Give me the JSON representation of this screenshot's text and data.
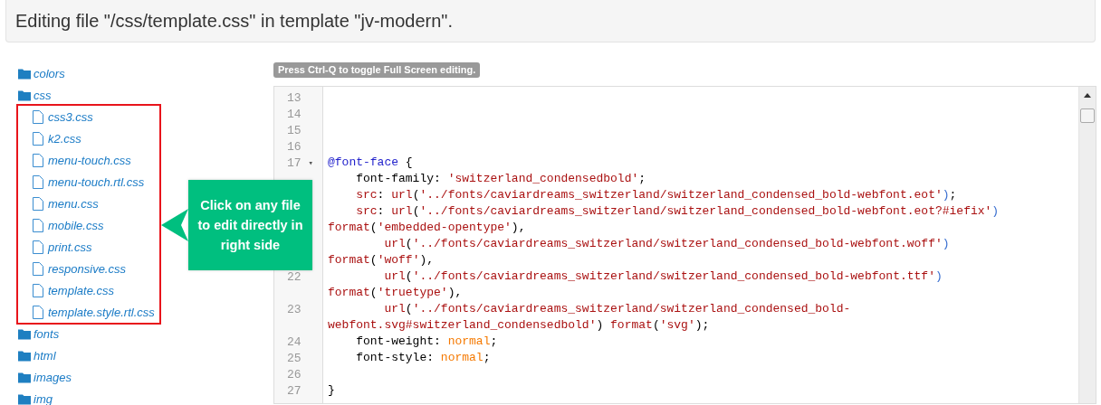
{
  "header": {
    "title": "Editing file \"/css/template.css\" in template \"jv-modern\"."
  },
  "tree": [
    {
      "kind": "folder",
      "name": "colors"
    },
    {
      "kind": "folder",
      "name": "css",
      "highlighted_children": true,
      "children": [
        {
          "kind": "file",
          "name": "css3.css"
        },
        {
          "kind": "file",
          "name": "k2.css"
        },
        {
          "kind": "file",
          "name": "menu-touch.css"
        },
        {
          "kind": "file",
          "name": "menu-touch.rtl.css"
        },
        {
          "kind": "file",
          "name": "menu.css"
        },
        {
          "kind": "file",
          "name": "mobile.css"
        },
        {
          "kind": "file",
          "name": "print.css"
        },
        {
          "kind": "file",
          "name": "responsive.css"
        },
        {
          "kind": "file",
          "name": "template.css"
        },
        {
          "kind": "file",
          "name": "template.style.rtl.css"
        }
      ]
    },
    {
      "kind": "folder",
      "name": "fonts"
    },
    {
      "kind": "folder",
      "name": "html"
    },
    {
      "kind": "folder",
      "name": "images"
    },
    {
      "kind": "folder",
      "name": "img"
    }
  ],
  "callout": {
    "text": "Click on any file to edit directly in right side"
  },
  "editor": {
    "hint": "Press Ctrl-Q to toggle Full Screen editing.",
    "lines": [
      {
        "number": "13"
      },
      {
        "number": "14"
      },
      {
        "number": "15"
      },
      {
        "number": "16"
      },
      {
        "number": "17",
        "fold_marker": "▾",
        "rows": [
          {
            "tokens": [
              {
                "kind": "kw",
                "text": "@font-face"
              },
              {
                "kind": "text",
                "text": " {"
              }
            ]
          }
        ]
      },
      {
        "rows": [
          {
            "tokens": [
              {
                "kind": "text",
                "text": "    font-family: "
              },
              {
                "kind": "str",
                "text": "'switzerland_condensedbold'"
              },
              {
                "kind": "text",
                "text": ";"
              }
            ]
          }
        ]
      },
      {
        "rows": [
          {
            "tokens": [
              {
                "kind": "str",
                "text": "    src"
              },
              {
                "kind": "text",
                "text": ": "
              },
              {
                "kind": "str",
                "text": "url"
              },
              {
                "kind": "text",
                "text": "("
              },
              {
                "kind": "str",
                "text": "'../fonts/caviardreams_switzerland/switzerland_condensed_bold-webfont.eot'"
              },
              {
                "kind": "paren",
                "text": ")"
              },
              {
                "kind": "text",
                "text": ";"
              }
            ]
          }
        ]
      },
      {
        "rows": [
          {
            "tokens": [
              {
                "kind": "str",
                "text": "    src"
              },
              {
                "kind": "text",
                "text": ": "
              },
              {
                "kind": "str",
                "text": "url"
              },
              {
                "kind": "text",
                "text": "("
              },
              {
                "kind": "str",
                "text": "'../fonts/caviardreams_switzerland/switzerland_condensed_bold-webfont.eot?#iefix'"
              },
              {
                "kind": "paren",
                "text": ")"
              }
            ]
          },
          {
            "tokens": [
              {
                "kind": "str",
                "text": "format"
              },
              {
                "kind": "text",
                "text": "("
              },
              {
                "kind": "str",
                "text": "'embedded-opentype'"
              },
              {
                "kind": "text",
                "text": "),"
              }
            ]
          }
        ]
      },
      {
        "rows": [
          {
            "tokens": [
              {
                "kind": "str",
                "text": "        url"
              },
              {
                "kind": "text",
                "text": "("
              },
              {
                "kind": "str",
                "text": "'../fonts/caviardreams_switzerland/switzerland_condensed_bold-webfont.woff'"
              },
              {
                "kind": "paren",
                "text": ")"
              }
            ]
          },
          {
            "tokens": [
              {
                "kind": "str",
                "text": "format"
              },
              {
                "kind": "text",
                "text": "("
              },
              {
                "kind": "str",
                "text": "'woff'"
              },
              {
                "kind": "text",
                "text": "),"
              }
            ]
          }
        ]
      },
      {
        "number": "22",
        "rows": [
          {
            "tokens": [
              {
                "kind": "str",
                "text": "        url"
              },
              {
                "kind": "text",
                "text": "("
              },
              {
                "kind": "str",
                "text": "'../fonts/caviardreams_switzerland/switzerland_condensed_bold-webfont.ttf'"
              },
              {
                "kind": "paren",
                "text": ")"
              }
            ]
          },
          {
            "tokens": [
              {
                "kind": "str",
                "text": "format"
              },
              {
                "kind": "text",
                "text": "("
              },
              {
                "kind": "str",
                "text": "'truetype'"
              },
              {
                "kind": "text",
                "text": "),"
              }
            ]
          }
        ]
      },
      {
        "number": "23",
        "rows": [
          {
            "tokens": [
              {
                "kind": "str",
                "text": "        url"
              },
              {
                "kind": "text",
                "text": "("
              },
              {
                "kind": "str",
                "text": "'../fonts/caviardreams_switzerland/switzerland_condensed_bold-"
              }
            ]
          },
          {
            "tokens": [
              {
                "kind": "str",
                "text": "webfont.svg#switzerland_condensedbold'"
              },
              {
                "kind": "text",
                "text": ") "
              },
              {
                "kind": "str",
                "text": "format"
              },
              {
                "kind": "text",
                "text": "("
              },
              {
                "kind": "str",
                "text": "'svg'"
              },
              {
                "kind": "text",
                "text": ");"
              }
            ]
          }
        ]
      },
      {
        "number": "24",
        "rows": [
          {
            "tokens": [
              {
                "kind": "text",
                "text": "    font-weight: "
              },
              {
                "kind": "atom",
                "text": "normal"
              },
              {
                "kind": "text",
                "text": ";"
              }
            ]
          }
        ]
      },
      {
        "number": "25",
        "rows": [
          {
            "tokens": [
              {
                "kind": "text",
                "text": "    font-style: "
              },
              {
                "kind": "atom",
                "text": "normal"
              },
              {
                "kind": "text",
                "text": ";"
              }
            ]
          }
        ]
      },
      {
        "number": "26"
      },
      {
        "number": "27",
        "rows": [
          {
            "tokens": [
              {
                "kind": "text",
                "text": "}"
              }
            ]
          }
        ]
      }
    ]
  }
}
